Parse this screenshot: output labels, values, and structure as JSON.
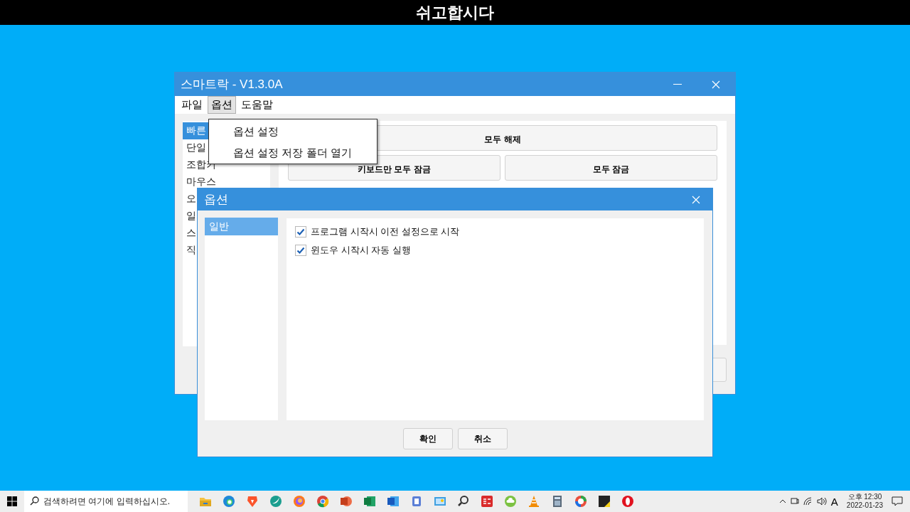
{
  "banner": {
    "title": "쉬고합시다"
  },
  "main_window": {
    "title": "스마트락 - V1.3.0A",
    "menu": [
      {
        "label": "파일",
        "selected": false
      },
      {
        "label": "옵션",
        "selected": true
      },
      {
        "label": "도움말",
        "selected": false
      }
    ],
    "sidebar": [
      {
        "label": "빠른",
        "selected": true
      },
      {
        "label": "단일",
        "selected": false
      },
      {
        "label": "조합키",
        "selected": false
      },
      {
        "label": "마우스",
        "selected": false
      },
      {
        "label": "오",
        "selected": false
      },
      {
        "label": "일",
        "selected": false
      },
      {
        "label": "스",
        "selected": false
      },
      {
        "label": "직",
        "selected": false
      }
    ],
    "buttons": [
      {
        "label": "모두 해제"
      },
      {
        "label": "키보드만 모두 잠금"
      },
      {
        "label": "모두 잠금"
      }
    ]
  },
  "menu_popup": {
    "items": [
      "옵션 설정",
      "옵션 설정 저장 폴더 열기"
    ]
  },
  "options_dialog": {
    "title": "옵션",
    "categories": [
      {
        "label": "일반",
        "selected": true
      }
    ],
    "settings": [
      {
        "label": "프로그램 시작시 이전 설정으로 시작",
        "checked": true
      },
      {
        "label": "윈도우 시작시 자동 실행",
        "checked": true
      }
    ],
    "buttons": [
      "확인",
      "취소"
    ]
  },
  "taskbar": {
    "search": {
      "placeholder": "검색하려면 여기에 입력하십시오."
    },
    "input_mode": "A",
    "time": "오후 12:30",
    "date": "2022-01-23"
  }
}
